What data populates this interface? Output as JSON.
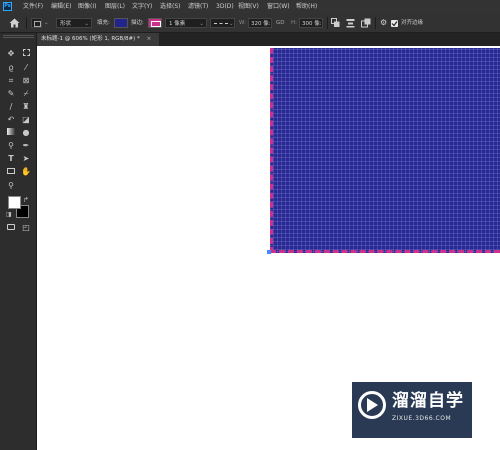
{
  "app": {
    "logo": "Ps"
  },
  "menubar": {
    "items": [
      "文件(F)",
      "编辑(E)",
      "图像(I)",
      "图层(L)",
      "文字(Y)",
      "选择(S)",
      "滤镜(T)",
      "3D(D)",
      "视图(V)",
      "窗口(W)",
      "帮助(H)"
    ]
  },
  "options": {
    "home_icon": "home-icon",
    "shape_mode": "形状",
    "fill_label": "填充:",
    "fill_color": "#23238c",
    "stroke_label": "描边:",
    "stroke_color": "#cc2f8c",
    "stroke_width": "1 像素",
    "w_label": "W:",
    "w_value": "320 像:",
    "link_icon": "GD",
    "h_label": "H:",
    "h_value": "300 像:",
    "align_edges_label": "对齐边缘",
    "align_edges_checked": true
  },
  "document": {
    "tab_title": "未标题-1 @ 606% (矩形 1, RGB/8#) *",
    "close_glyph": "×"
  },
  "toolbox": {
    "tools": [
      "move-tool",
      "marquee-tool",
      "lasso-tool",
      "magic-wand-tool",
      "crop-tool",
      "frame-tool",
      "eyedropper-tool",
      "healing-brush-tool",
      "brush-tool",
      "clone-stamp-tool",
      "history-brush-tool",
      "eraser-tool",
      "gradient-tool",
      "blur-tool",
      "dodge-tool",
      "pen-tool",
      "type-tool",
      "path-selection-tool",
      "rectangle-tool",
      "hand-tool",
      "zoom-tool"
    ],
    "type_tool_glyph": "T",
    "foreground_color": "#ffffff",
    "background_color": "#000000"
  },
  "canvas": {
    "background": "#ffffff",
    "shape_fill": "#282896",
    "shape_stroke": "#cc2f8c"
  },
  "watermark": {
    "title": "溜溜自学",
    "url": "ZIXUE.3D66.COM"
  }
}
